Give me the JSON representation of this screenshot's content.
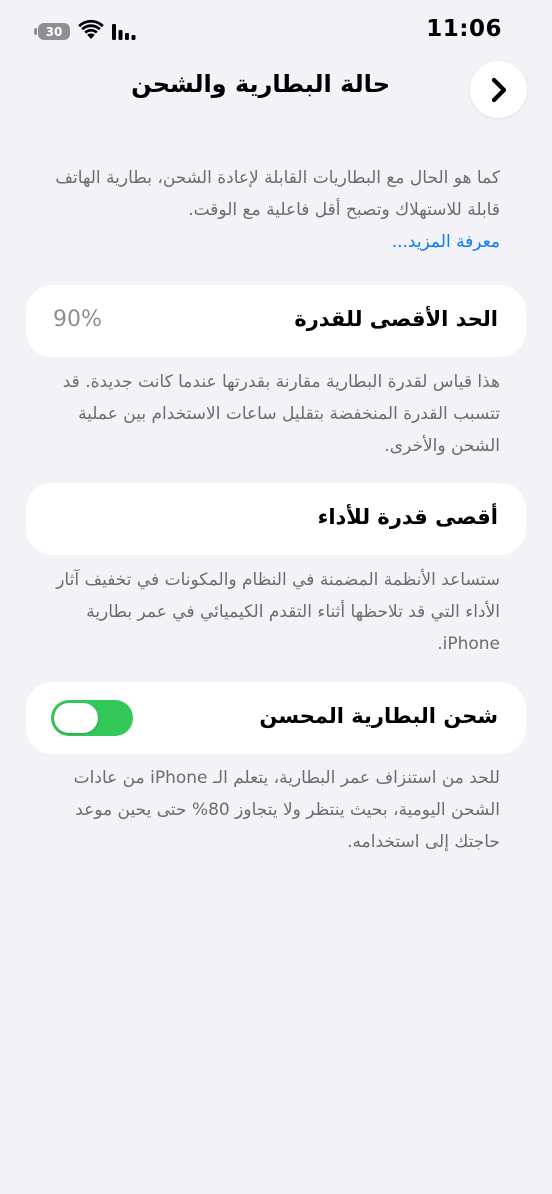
{
  "status_bar": {
    "time": "11:06",
    "battery_level": "30",
    "icons": [
      "battery-icon",
      "wifi-icon",
      "cellular-signal-icon"
    ]
  },
  "nav": {
    "title": "حالة البطارية والشحن",
    "back_icon": "chevron-right-icon"
  },
  "intro": {
    "text": "كما هو الحال مع البطاريات القابلة لإعادة الشحن، بطارية الهاتف قابلة للاستهلاك وتصبح أقل فاعلية مع الوقت.",
    "learn_more": "معرفة المزيد..."
  },
  "max_capacity": {
    "label": "الحد الأقصى للقدرة",
    "value": "90%",
    "footnote": "هذا قياس لقدرة البطارية مقارنة بقدرتها عندما كانت جديدة. قد تتسبب القدرة المنخفضة بتقليل ساعات الاستخدام بين عملية الشحن والأخرى."
  },
  "peak_performance": {
    "label": "أقصى قدرة للأداء",
    "footnote": "ستساعد الأنظمة المضمنة في النظام والمكونات في تخفيف آثار الأداء التي قد تلاحظها أثناء التقدم الكيميائي في عمر بطارية iPhone."
  },
  "optimized_charging": {
    "label": "شحن البطارية المحسن",
    "enabled": true,
    "footnote": "للحد من استنزاف عمر البطارية، يتعلم الـ iPhone من عادات الشحن اليومية، بحيث ينتظر ولا يتجاوز 80% حتى يحين موعد حاجتك إلى استخدامه."
  },
  "colors": {
    "background": "#f2f2f7",
    "card": "#ffffff",
    "accent_link": "#0a7aff",
    "toggle_on": "#34c759",
    "secondary_text": "#6c6c70"
  }
}
